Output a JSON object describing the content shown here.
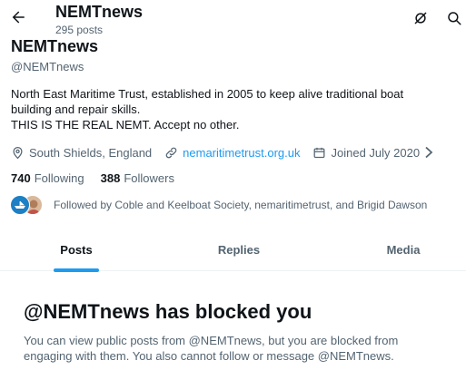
{
  "header": {
    "title": "NEMTnews",
    "post_count": "295 posts",
    "back_icon": "arrow-left-icon",
    "icons": [
      "translate-icon",
      "search-icon"
    ]
  },
  "profile": {
    "name": "NEMTnews",
    "handle": "@NEMTnews",
    "bio_lines": [
      "North East Maritime Trust, established in 2005 to keep alive traditional boat",
      "building and repair skills.",
      "THIS IS THE REAL NEMT. Accept no other."
    ],
    "location": "South Shields, England",
    "website": "nemaritimetrust.org.uk",
    "joined": "Joined July 2020",
    "following_count": "740",
    "following_label": "Following",
    "followers_count": "388",
    "followers_label": "Followers",
    "followed_by": "Followed by Coble and Keelboat Society, nemaritimetrust, and Brigid Dawson"
  },
  "tabs": [
    {
      "label": "Posts",
      "active": true
    },
    {
      "label": "Replies",
      "active": false
    },
    {
      "label": "Media",
      "active": false
    }
  ],
  "blocked": {
    "title": "@NEMTnews has blocked you",
    "message_lines": [
      "You can view public posts from @NEMTnews, but you are blocked from",
      "engaging with them. You also cannot follow or message @NEMTnews."
    ]
  },
  "colors": {
    "accent": "#1d9bf0",
    "text_primary": "#0f1419",
    "text_secondary": "#536471"
  }
}
